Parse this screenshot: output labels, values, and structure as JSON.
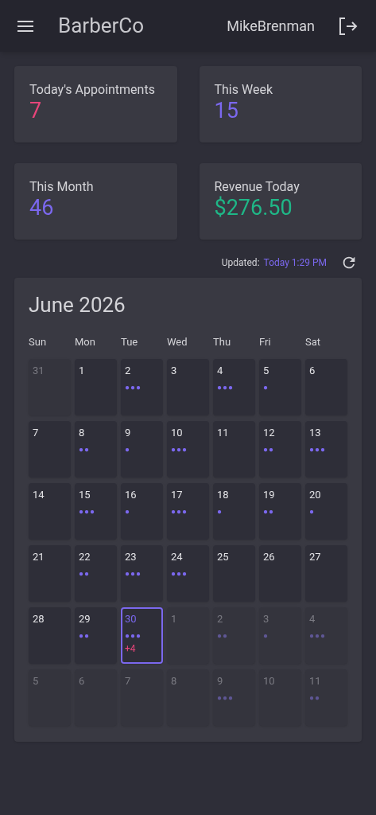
{
  "header": {
    "title": "BarberCo",
    "user": "MikeBrenman"
  },
  "stats": [
    {
      "label": "Today's Appointments",
      "value": "7",
      "color": "#e8457a"
    },
    {
      "label": "This Week",
      "value": "15",
      "color": "#7b68ee"
    },
    {
      "label": "This Month",
      "value": "46",
      "color": "#7b68ee"
    },
    {
      "label": "Revenue Today",
      "value": "$276.50",
      "color": "#1fb787"
    }
  ],
  "updated": {
    "label": "Updated:",
    "time": "Today 1:29 PM"
  },
  "calendar": {
    "title": "June 2026",
    "weekdays": [
      "Sun",
      "Mon",
      "Tue",
      "Wed",
      "Thu",
      "Fri",
      "Sat"
    ],
    "days": [
      {
        "day": "31",
        "in_month": false,
        "selected": false
      },
      {
        "day": "1",
        "in_month": true,
        "selected": false
      },
      {
        "day": "2",
        "in_month": true,
        "selected": false,
        "dots": "●●●"
      },
      {
        "day": "3",
        "in_month": true,
        "selected": false
      },
      {
        "day": "4",
        "in_month": true,
        "selected": false,
        "dots": "●●●"
      },
      {
        "day": "5",
        "in_month": true,
        "selected": false,
        "dots": "●"
      },
      {
        "day": "6",
        "in_month": true,
        "selected": false
      },
      {
        "day": "7",
        "in_month": true,
        "selected": false
      },
      {
        "day": "8",
        "in_month": true,
        "selected": false,
        "dots": "●●"
      },
      {
        "day": "9",
        "in_month": true,
        "selected": false,
        "dots": "●"
      },
      {
        "day": "10",
        "in_month": true,
        "selected": false,
        "dots": "●●●"
      },
      {
        "day": "11",
        "in_month": true,
        "selected": false
      },
      {
        "day": "12",
        "in_month": true,
        "selected": false,
        "dots": "●●"
      },
      {
        "day": "13",
        "in_month": true,
        "selected": false,
        "dots": "●●●"
      },
      {
        "day": "14",
        "in_month": true,
        "selected": false
      },
      {
        "day": "15",
        "in_month": true,
        "selected": false,
        "dots": "●●●"
      },
      {
        "day": "16",
        "in_month": true,
        "selected": false,
        "dots": "●"
      },
      {
        "day": "17",
        "in_month": true,
        "selected": false,
        "dots": "●●●"
      },
      {
        "day": "18",
        "in_month": true,
        "selected": false,
        "dots": "●"
      },
      {
        "day": "19",
        "in_month": true,
        "selected": false,
        "dots": "●●"
      },
      {
        "day": "20",
        "in_month": true,
        "selected": false,
        "dots": "●"
      },
      {
        "day": "21",
        "in_month": true,
        "selected": false
      },
      {
        "day": "22",
        "in_month": true,
        "selected": false,
        "dots": "●●"
      },
      {
        "day": "23",
        "in_month": true,
        "selected": false,
        "dots": "●●●"
      },
      {
        "day": "24",
        "in_month": true,
        "selected": false,
        "dots": "●●●"
      },
      {
        "day": "25",
        "in_month": true,
        "selected": false
      },
      {
        "day": "26",
        "in_month": true,
        "selected": false
      },
      {
        "day": "27",
        "in_month": true,
        "selected": false
      },
      {
        "day": "28",
        "in_month": true,
        "selected": false
      },
      {
        "day": "29",
        "in_month": true,
        "selected": false,
        "dots": "●●"
      },
      {
        "day": "30",
        "in_month": true,
        "selected": true,
        "dots": "●●●",
        "more": "+4"
      },
      {
        "day": "1",
        "in_month": false,
        "selected": false
      },
      {
        "day": "2",
        "in_month": false,
        "selected": false,
        "dots": "●●"
      },
      {
        "day": "3",
        "in_month": false,
        "selected": false,
        "dots": "●"
      },
      {
        "day": "4",
        "in_month": false,
        "selected": false,
        "dots": "●●●"
      },
      {
        "day": "5",
        "in_month": false,
        "selected": false
      },
      {
        "day": "6",
        "in_month": false,
        "selected": false
      },
      {
        "day": "7",
        "in_month": false,
        "selected": false
      },
      {
        "day": "8",
        "in_month": false,
        "selected": false
      },
      {
        "day": "9",
        "in_month": false,
        "selected": false,
        "dots": "●●●"
      },
      {
        "day": "10",
        "in_month": false,
        "selected": false
      },
      {
        "day": "11",
        "in_month": false,
        "selected": false,
        "dots": "●●"
      }
    ]
  }
}
